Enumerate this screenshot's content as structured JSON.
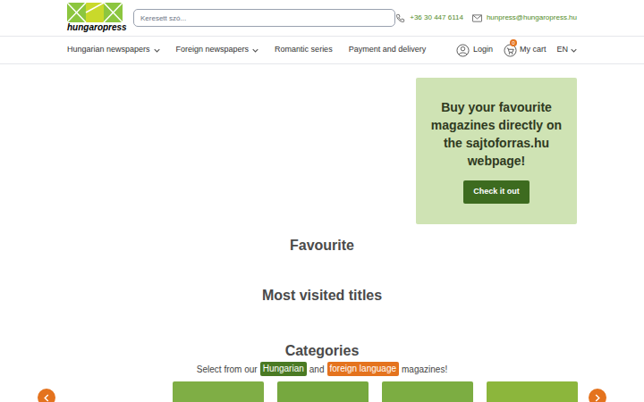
{
  "header": {
    "logo": "hungaropress",
    "search": {
      "placeholder": "Keresett szó..."
    },
    "phone": "+36 30 447 6114",
    "email": "hunpress@hungaropress.hu"
  },
  "nav": {
    "items": [
      {
        "label": "Hungarian newspapers",
        "dropdown": true
      },
      {
        "label": "Foreign newspapers",
        "dropdown": true
      },
      {
        "label": "Romantic series",
        "dropdown": false
      },
      {
        "label": "Payment and delivery",
        "dropdown": false
      }
    ],
    "login": "Login",
    "cart": {
      "label": "My cart",
      "count": "0"
    },
    "language": {
      "label": "EN",
      "dropdown": true
    }
  },
  "banner": {
    "text": "Buy your favourite magazines directly on the sajtoforras.hu webpage!",
    "button": "Check it out"
  },
  "sections": {
    "favourite": "Favourite",
    "most_visited": "Most visited titles"
  },
  "categories": {
    "title": "Categories",
    "intro": [
      {
        "text": "Select from our",
        "kind": "plain"
      },
      {
        "text": "Hungarian",
        "kind": "badge",
        "color": "#4a7a23"
      },
      {
        "text": "and",
        "kind": "plain"
      },
      {
        "text": "foreign language",
        "kind": "badge",
        "color": "#e4731e"
      },
      {
        "text": "magazines!",
        "kind": "plain"
      }
    ],
    "cards": [
      {
        "color": "#7fae45"
      },
      {
        "color": "#76a83f"
      },
      {
        "color": "#7cad42"
      },
      {
        "color": "#8cb63c"
      }
    ]
  }
}
